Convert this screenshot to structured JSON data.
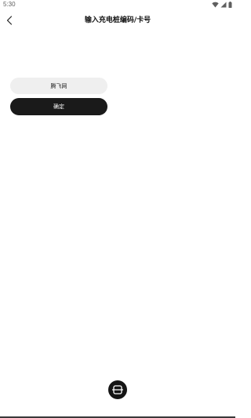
{
  "status_bar": {
    "time": "5:30",
    "icons": [
      "wifi-icon",
      "signal-icon",
      "battery-icon"
    ]
  },
  "header": {
    "back_icon": "chevron-left-icon",
    "title": "输入充电桩编码/卡号"
  },
  "form": {
    "code_input": {
      "value": "腾飞网",
      "placeholder": ""
    },
    "confirm_label": "确定"
  },
  "scan": {
    "icon": "scan-icon"
  },
  "colors": {
    "background": "#ffffff",
    "input_bg": "#efefef",
    "button_bg": "#1a1a1a",
    "button_text": "#ffffff",
    "scan_bg": "#151515"
  }
}
